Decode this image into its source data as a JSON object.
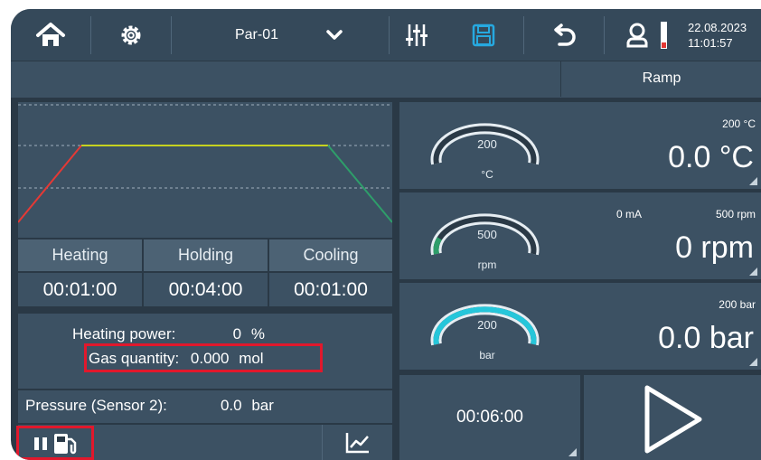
{
  "header": {
    "program": "Par-01",
    "date": "22.08.2023",
    "time": "11:01:57",
    "icons": [
      "home-icon",
      "gear-icon",
      "chevron-down-icon",
      "sliders-icon",
      "save-icon",
      "undo-icon",
      "user-icon",
      "level-icon"
    ]
  },
  "mode_label": "Ramp",
  "phases": [
    {
      "label": "Heating",
      "time": "00:01:00"
    },
    {
      "label": "Holding",
      "time": "00:04:00"
    },
    {
      "label": "Cooling",
      "time": "00:01:00"
    }
  ],
  "info": {
    "heating_power_label": "Heating power:",
    "heating_power_value": "0",
    "heating_power_unit": "%",
    "gas_quantity_label": "Gas quantity:",
    "gas_quantity_value": "0.000",
    "gas_quantity_unit": "mol",
    "pressure2_label": "Pressure (Sensor 2):",
    "pressure2_value": "0.0",
    "pressure2_unit": "bar"
  },
  "gauges": {
    "temperature": {
      "setpoint": "200",
      "unit": "°C",
      "limit": "200 °C",
      "value": "0.0 °C",
      "fill": 0.0
    },
    "stirrer": {
      "setpoint": "500",
      "unit": "rpm",
      "current": "0 mA",
      "limit": "500 rpm",
      "value": "0 rpm",
      "fill": 0.12
    },
    "pressure": {
      "setpoint": "200",
      "unit": "bar",
      "limit": "200 bar",
      "value": "0.0 bar",
      "fill": 1.0
    }
  },
  "timer": "00:06:00",
  "colors": {
    "accent": "#26c6da",
    "heating": "#e53935",
    "holding": "#c6d21f",
    "cooling": "#2e9e6a",
    "highlight": "#e1182c",
    "save_icon": "#26a9e0"
  }
}
